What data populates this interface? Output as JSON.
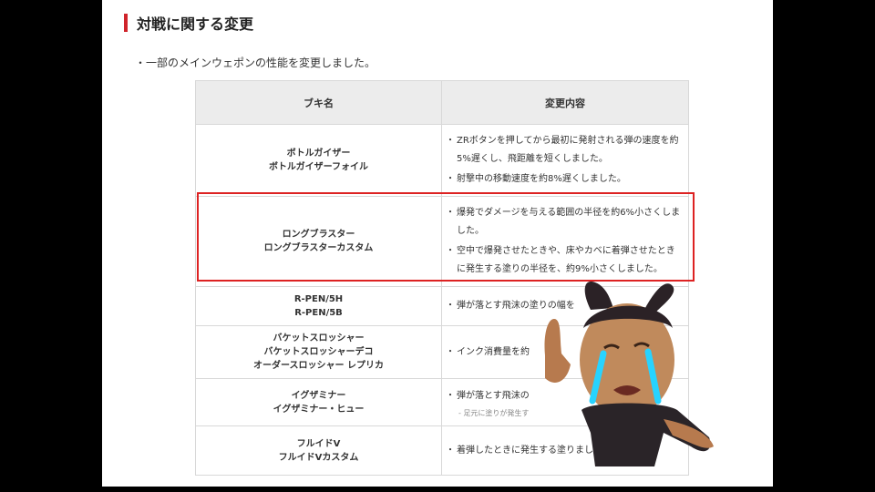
{
  "section": {
    "title": "対戦に関する変更"
  },
  "intro": "・一部のメインウェポンの性能を変更しました。",
  "table": {
    "headers": [
      "ブキ名",
      "変更内容"
    ],
    "rows": [
      {
        "names": [
          "ボトルガイザー",
          "ボトルガイザーフォイル"
        ],
        "changes": [
          "ZRボタンを押してから最初に発射される弾の速度を約5%遅くし、飛距離を短くしました。",
          "射撃中の移動速度を約8%遅くしました。"
        ],
        "note": ""
      },
      {
        "names": [
          "ロングブラスター",
          "ロングブラスターカスタム"
        ],
        "changes": [
          "爆発でダメージを与える範囲の半径を約6%小さくしました。",
          "空中で爆発させたときや、床やカベに着弾させたときに発生する塗りの半径を、約9%小さくしました。"
        ],
        "note": ""
      },
      {
        "names": [
          "R-PEN/5H",
          "R-PEN/5B"
        ],
        "changes": [
          "弾が落とす飛沫の塗りの幅を"
        ],
        "note": ""
      },
      {
        "names": [
          "バケットスロッシャー",
          "バケットスロッシャーデコ",
          "オーダースロッシャー レプリカ"
        ],
        "changes": [
          "インク消費量を約"
        ],
        "note": ""
      },
      {
        "names": [
          "イグザミナー",
          "イグザミナー・ヒュー"
        ],
        "changes": [
          "弾が落とす飛沫の"
        ],
        "note": "- 足元に塗りが発生す"
      },
      {
        "names": [
          "フルイドV",
          "フルイドVカスタム"
        ],
        "changes": [
          "着弾したときに発生する塗りました。"
        ],
        "note": ""
      }
    ]
  },
  "colors": {
    "accent": "#d0242b",
    "header_bg": "#ececec",
    "highlight": "#dd2222"
  }
}
